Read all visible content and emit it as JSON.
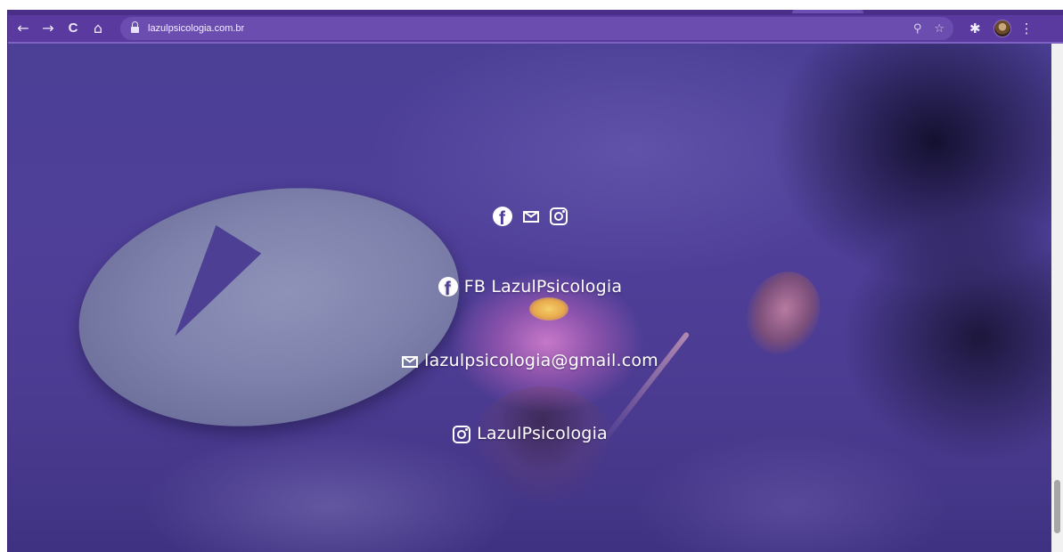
{
  "browser": {
    "url": "lazulpsicologia.com.br",
    "back_icon": "←",
    "forward_icon": "→",
    "reload_icon": "C",
    "home_icon": "⌂",
    "zoom_icon": "⚲",
    "star_icon": "☆",
    "extensions_icon": "✱",
    "menu_icon": "⋮"
  },
  "contact": {
    "facebook_label": "FB LazulPsicologia",
    "email_label": "lazulpsicologia@gmail.com",
    "instagram_label": "LazulPsicologia"
  },
  "colors": {
    "chrome": "#5a3a9e",
    "omnibox": "#6b4db0",
    "page_background": "#4b3f96",
    "text": "#ffffff"
  }
}
